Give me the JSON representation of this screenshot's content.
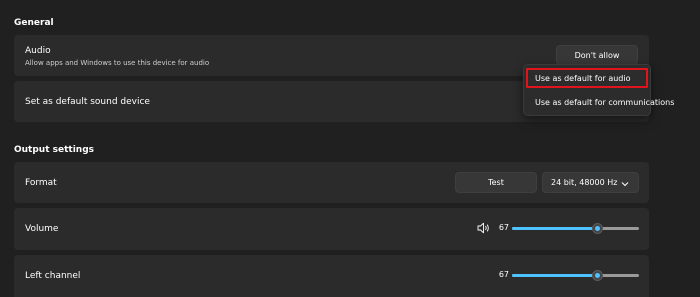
{
  "general": {
    "section_title": "General",
    "audio_card": {
      "title": "Audio",
      "description": "Allow apps and Windows to use this device for audio",
      "button_label": "Don't allow"
    },
    "default_device_card": {
      "title": "Set as default sound device"
    },
    "default_menu": {
      "items": [
        {
          "label": "Use as default for audio",
          "highlighted": true
        },
        {
          "label": "Use as default for communications",
          "highlighted": false
        }
      ]
    }
  },
  "output": {
    "section_title": "Output settings",
    "format_card": {
      "title": "Format",
      "test_label": "Test",
      "format_value": "24 bit, 48000 Hz",
      "chevron_icon": "chevron-down-icon"
    },
    "volume_card": {
      "title": "Volume",
      "icon": "speaker-icon",
      "value": "67",
      "level": 0.67
    },
    "left_channel_card": {
      "title": "Left channel",
      "value": "67",
      "level": 0.67
    }
  },
  "colors": {
    "accent": "#4cc2ff",
    "highlight_border": "#e0141b",
    "card_bg": "#2b2b2b",
    "page_bg": "#202020"
  }
}
